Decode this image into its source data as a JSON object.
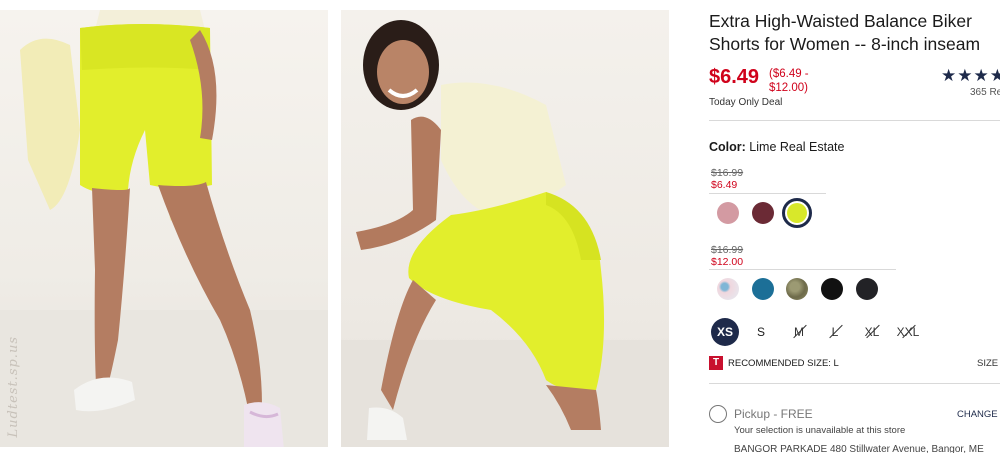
{
  "product": {
    "title_line1": "Extra High-Waisted Balance Biker",
    "title_line2": "Shorts for Women -- 8-inch inseam",
    "price": "$6.49",
    "price_range_line1": "($6.49 -",
    "price_range_line2": "$12.00)",
    "deal_label": "Today Only Deal",
    "stars": "★★★★",
    "review_count": "365 Re",
    "watermark": "Ludtest.sp.us"
  },
  "color": {
    "label": "Color:",
    "value": "Lime Real Estate",
    "group1": {
      "was_price": "$16.99",
      "now_price": "$6.49",
      "swatches": [
        {
          "name": "rose",
          "color": "#d39aa2"
        },
        {
          "name": "burgundy",
          "color": "#6b2a35"
        },
        {
          "name": "lime",
          "color": "#d8e82a",
          "selected": true
        }
      ]
    },
    "group2": {
      "was_price": "$16.99",
      "now_price": "$12.00",
      "swatches": [
        {
          "name": "tie-dye",
          "color": "#e8e0e6"
        },
        {
          "name": "teal-blue",
          "color": "#1c6f97"
        },
        {
          "name": "olive-camo",
          "color": "#7d7b58"
        },
        {
          "name": "black",
          "color": "#111111"
        },
        {
          "name": "charcoal",
          "color": "#222226"
        }
      ]
    }
  },
  "sizes": [
    {
      "label": "XS",
      "state": "selected"
    },
    {
      "label": "S",
      "state": "available"
    },
    {
      "label": "M",
      "state": "unavailable"
    },
    {
      "label": "L",
      "state": "unavailable"
    },
    {
      "label": "XL",
      "state": "unavailable"
    },
    {
      "label": "XXL",
      "state": "unavailable"
    }
  ],
  "recommend": {
    "icon_letter": "T",
    "text": "RECOMMENDED SIZE: L",
    "size_link": "SIZE"
  },
  "pickup": {
    "label": "Pickup - FREE",
    "change_link": "CHANGE S",
    "unavailable_text": "Your selection is unavailable at this store",
    "address": "BANGOR PARKADE 480 Stillwater Avenue, Bangor, ME"
  },
  "colors": {
    "accent_red": "#d0021b",
    "navy": "#1e2a4a",
    "shorts_lime": "#e2ee2c"
  }
}
